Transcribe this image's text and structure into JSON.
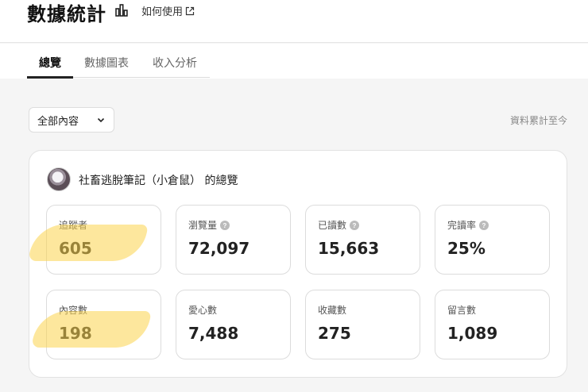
{
  "header": {
    "title": "數據統計",
    "howto_label": "如何使用"
  },
  "tabs": [
    {
      "label": "總覽",
      "active": true
    },
    {
      "label": "數據圖表",
      "active": false
    },
    {
      "label": "收入分析",
      "active": false
    }
  ],
  "filter": {
    "selected": "全部內容",
    "cumulative_label": "資料累計至今"
  },
  "overview": {
    "title": "社畜逃脫筆記（小倉鼠） 的總覽",
    "stats": [
      {
        "label": "追蹤者",
        "value": "605",
        "help": false,
        "highlighted": true
      },
      {
        "label": "瀏覽量",
        "value": "72,097",
        "help": true,
        "highlighted": false
      },
      {
        "label": "已讀數",
        "value": "15,663",
        "help": true,
        "highlighted": false
      },
      {
        "label": "完讀率",
        "value": "25%",
        "help": true,
        "highlighted": false
      },
      {
        "label": "內容數",
        "value": "198",
        "help": false,
        "highlighted": true
      },
      {
        "label": "愛心數",
        "value": "7,488",
        "help": false,
        "highlighted": false
      },
      {
        "label": "收藏數",
        "value": "275",
        "help": false,
        "highlighted": false
      },
      {
        "label": "留言數",
        "value": "1,089",
        "help": false,
        "highlighted": false
      }
    ]
  },
  "colors": {
    "highlight": "#fcd34d",
    "text": "#222222",
    "muted": "#888888"
  }
}
